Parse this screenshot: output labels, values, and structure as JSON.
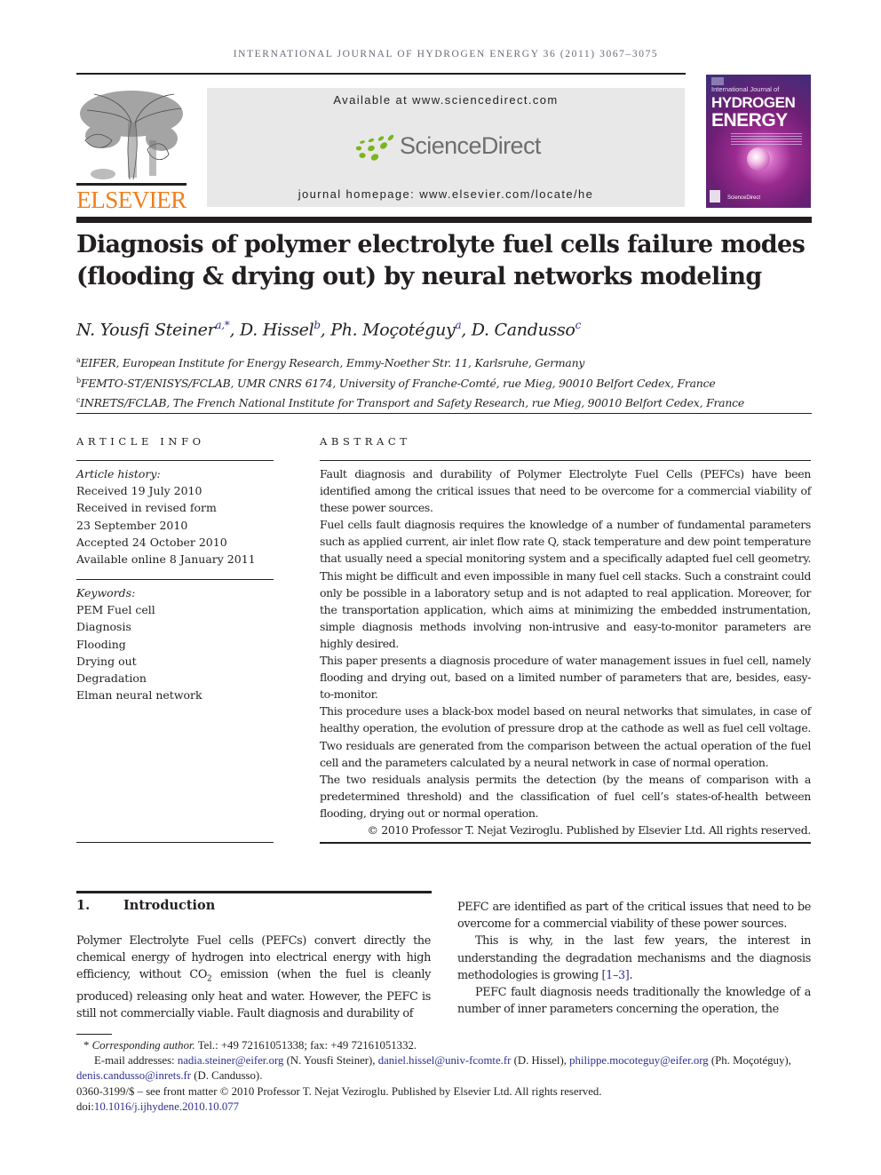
{
  "header": {
    "running_head": "INTERNATIONAL JOURNAL OF HYDROGEN ENERGY 36 (2011) 3067–3075",
    "publisher_logo": "ELSEVIER",
    "available_at": "Available at www.sciencedirect.com",
    "platform_logo": "ScienceDirect",
    "journal_homepage": "journal homepage: www.elsevier.com/locate/he",
    "cover": {
      "line1": "International Journal of",
      "line2": "HYDROGEN",
      "line3": "ENERGY",
      "footer": "ScienceDirect"
    }
  },
  "colors": {
    "elsevier_orange": "#f07d1a",
    "sciencedirect_green": "#7ab51d",
    "link_blue": "#2e3192",
    "banner_gray": "#e8e8e8"
  },
  "article": {
    "title": "Diagnosis of polymer electrolyte fuel cells failure modes (flooding & drying out) by neural networks modeling",
    "authors": [
      {
        "name": "N. Yousfi Steiner",
        "sup": "a,*"
      },
      {
        "name": "D. Hissel",
        "sup": "b"
      },
      {
        "name": "Ph. Moçotéguy",
        "sup": "a"
      },
      {
        "name": "D. Candusso",
        "sup": "c"
      }
    ],
    "affiliations": [
      {
        "mark": "a",
        "text": "EIFER, European Institute for Energy Research, Emmy-Noether Str. 11, Karlsruhe, Germany"
      },
      {
        "mark": "b",
        "text": "FEMTO-ST/ENISYS/FCLAB, UMR CNRS 6174, University of Franche-Comté, rue Mieg, 90010 Belfort Cedex, France"
      },
      {
        "mark": "c",
        "text": "INRETS/FCLAB, The French National Institute for Transport and Safety Research, rue Mieg, 90010 Belfort Cedex, France"
      }
    ]
  },
  "article_info": {
    "heading": "ARTICLE INFO",
    "history_label": "Article history:",
    "history": [
      "Received 19 July 2010",
      "Received in revised form",
      "23 September 2010",
      "Accepted 24 October 2010",
      "Available online 8 January 2011"
    ],
    "keywords_label": "Keywords:",
    "keywords": [
      "PEM Fuel cell",
      "Diagnosis",
      "Flooding",
      "Drying out",
      "Degradation",
      "Elman neural network"
    ]
  },
  "abstract": {
    "heading": "ABSTRACT",
    "paragraphs": [
      "Fault diagnosis and durability of Polymer Electrolyte Fuel Cells (PEFCs) have been identified among the critical issues that need to be overcome for a commercial viability of these power sources.",
      "Fuel cells fault diagnosis requires the knowledge of a number of fundamental parameters such as applied current, air inlet flow rate Q, stack temperature and dew point temperature that usually need a special monitoring system and a specifically adapted fuel cell geometry. This might be difficult and even impossible in many fuel cell stacks. Such a constraint could only be possible in a laboratory setup and is not adapted to real application. Moreover, for the transportation application, which aims at minimizing the embedded instrumentation, simple diagnosis methods involving non-intrusive and easy-to-monitor parameters are highly desired.",
      "This paper presents a diagnosis procedure of water management issues in fuel cell, namely flooding and drying out, based on a limited number of parameters that are, besides, easy-to-monitor.",
      "This procedure uses a black-box model based on neural networks that simulates, in case of healthy operation, the evolution of pressure drop at the cathode as well as fuel cell voltage. Two residuals are generated from the comparison between the actual operation of the fuel cell and the parameters calculated by a neural network in case of normal operation.",
      "The two residuals analysis permits the detection (by the means of comparison with a predetermined threshold) and the classification of fuel cell’s states-of-health between flooding, drying out or normal operation."
    ],
    "copyright": "© 2010 Professor T. Nejat Veziroglu. Published by Elsevier Ltd. All rights reserved."
  },
  "introduction": {
    "number": "1.",
    "heading": "Introduction",
    "left_col": {
      "p1_before_sub": "Polymer Electrolyte Fuel cells (PEFCs) convert directly the chemical energy of hydrogen into electrical energy with high efficiency, without CO",
      "p1_sub": "2",
      "p1_after_sub": " emission (when the fuel is cleanly produced) releasing only heat and water. However, the PEFC is still not commercially viable. Fault diagnosis and durability of"
    },
    "right_col": {
      "p1": "PEFC are identified as part of the critical issues that need to be overcome for a commercial viability of these power sources.",
      "p2_text": "This is why, in the last few years, the interest in understanding the degradation mechanisms and the diagnosis methodologies is growing ",
      "p2_cite": "[1–3]",
      "p2_end": ".",
      "p3": "PEFC fault diagnosis needs traditionally the knowledge of a number of inner parameters concerning the operation, the"
    }
  },
  "footnotes": {
    "corresponding_mark": "*",
    "corresponding_label": "Corresponding author.",
    "contact": " Tel.: +49 72161051338; fax: +49 72161051332.",
    "email_label": "E-mail addresses: ",
    "emails": [
      {
        "address": "nadia.steiner@eifer.org",
        "owner": " (N. Yousfi Steiner), "
      },
      {
        "address": "daniel.hissel@univ-fcomte.fr",
        "owner": " (D. Hissel), "
      },
      {
        "address": "philippe.mocoteguy@eifer.org",
        "owner": " (Ph. Moçotéguy), "
      },
      {
        "address": "denis.candusso@inrets.fr",
        "owner": " (D. Candusso)."
      }
    ],
    "front_matter": "0360-3199/$ – see front matter © 2010 Professor T. Nejat Veziroglu. Published by Elsevier Ltd. All rights reserved.",
    "doi_label": "doi:",
    "doi": "10.1016/j.ijhydene.2010.10.077"
  }
}
